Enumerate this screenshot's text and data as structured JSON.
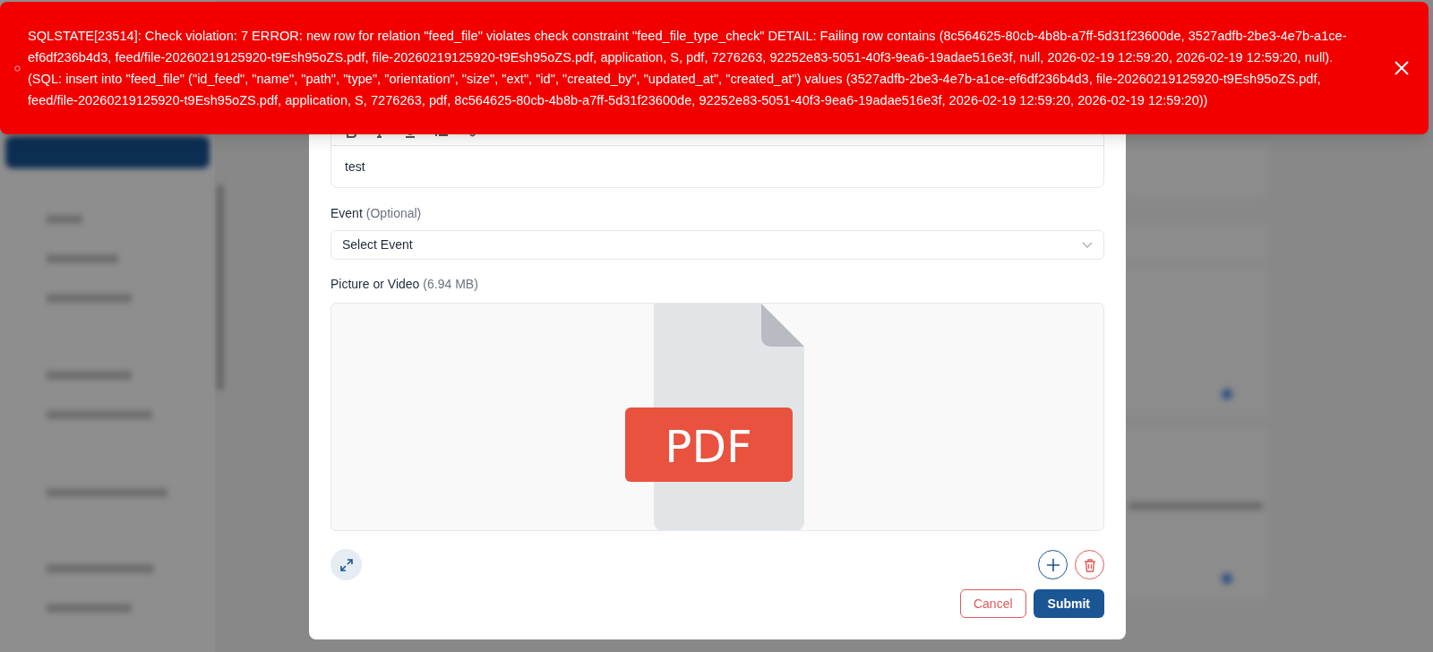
{
  "toast": {
    "kind": "error",
    "message": "SQLSTATE[23514]: Check violation: 7 ERROR: new row for relation \"feed_file\" violates check constraint \"feed_file_type_check\" DETAIL: Failing row contains (8c564625-80cb-4b8b-a7ff-5d31f23600de, 3527adfb-2be3-4e7b-a1ce-ef6df236b4d3, feed/file-20260219125920-t9Esh95oZS.pdf, file-20260219125920-t9Esh95oZS.pdf, application, S, pdf, 7276263, 92252e83-5051-40f3-9ea6-19adae516e3f, null, 2026-02-19 12:59:20, 2026-02-19 12:59:20, null). (SQL: insert into \"feed_file\" (\"id_feed\", \"name\", \"path\", \"type\", \"orientation\", \"size\", \"ext\", \"id\", \"created_by\", \"updated_at\", \"created_at\") values (3527adfb-2be3-4e7b-a1ce-ef6df236b4d3, file-20260219125920-t9Esh95oZS.pdf, feed/file-20260219125920-t9Esh95oZS.pdf, application, S, 7276263, pdf, 8c564625-80cb-4b8b-a7ff-5d31f23600de, 92252e83-5051-40f3-9ea6-19adae516e3f, 2026-02-19 12:59:20, 2026-02-19 12:59:20))"
  },
  "editor": {
    "content": "test"
  },
  "event": {
    "label": "Event",
    "hint": "(Optional)",
    "placeholder": "Select Event"
  },
  "media": {
    "label": "Picture or Video",
    "size": "(6.94 MB)",
    "file_badge": "PDF"
  },
  "buttons": [
    {
      "kind": "cancel",
      "label": "Cancel"
    },
    {
      "kind": "submit",
      "label": "Submit"
    }
  ]
}
